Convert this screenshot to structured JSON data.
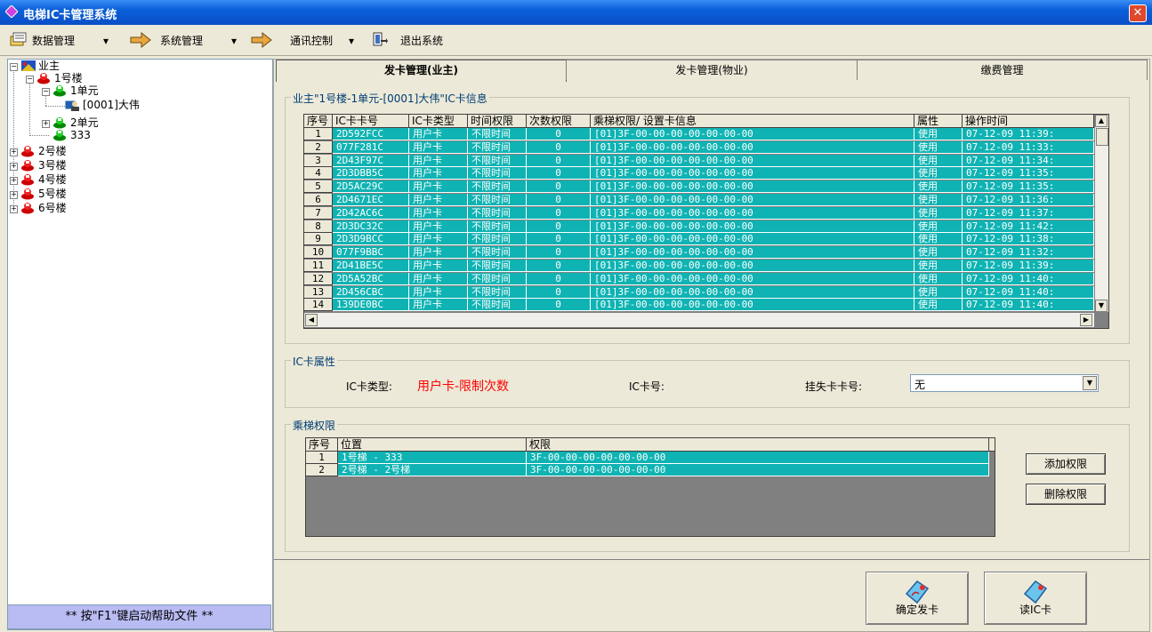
{
  "window": {
    "title": "电梯IC卡管理系统",
    "close": "✕"
  },
  "menu": [
    {
      "label": "数据管理",
      "arrow": "▾"
    },
    {
      "label": "系统管理",
      "arrow": "▾"
    },
    {
      "label": "通讯控制",
      "arrow": "▾"
    },
    {
      "label": "退出系统"
    }
  ],
  "tree": {
    "root": "业主",
    "building1": "1号楼",
    "unit1": "1单元",
    "owner": "[0001]大伟",
    "unit2": "2单元",
    "unit333": "333",
    "b2": "2号楼",
    "b3": "3号楼",
    "b4": "4号楼",
    "b5": "5号楼",
    "b6": "6号楼"
  },
  "help_text": "** 按\"F1\"键启动帮助文件 **",
  "tabs": [
    "发卡管理(业主)",
    "发卡管理(物业)",
    "缴费管理"
  ],
  "card_info": {
    "title": "业主\"1号楼-1单元-[0001]大伟\"IC卡信息",
    "columns": [
      "序号",
      "IC卡卡号",
      "IC卡类型",
      "时间权限",
      "次数权限",
      "乘梯权限/ 设置卡信息",
      "属性",
      "操作时间"
    ],
    "rows": [
      [
        "1",
        "2D592FCC",
        "用户卡",
        "不限时间",
        "0",
        "[01]3F-00-00-00-00-00-00-00",
        "使用",
        "07-12-09 11:39:"
      ],
      [
        "2",
        "077F281C",
        "用户卡",
        "不限时间",
        "0",
        "[01]3F-00-00-00-00-00-00-00",
        "使用",
        "07-12-09 11:33:"
      ],
      [
        "3",
        "2D43F97C",
        "用户卡",
        "不限时间",
        "0",
        "[01]3F-00-00-00-00-00-00-00",
        "使用",
        "07-12-09 11:34:"
      ],
      [
        "4",
        "2D3DBB5C",
        "用户卡",
        "不限时间",
        "0",
        "[01]3F-00-00-00-00-00-00-00",
        "使用",
        "07-12-09 11:35:"
      ],
      [
        "5",
        "2D5AC29C",
        "用户卡",
        "不限时间",
        "0",
        "[01]3F-00-00-00-00-00-00-00",
        "使用",
        "07-12-09 11:35:"
      ],
      [
        "6",
        "2D4671EC",
        "用户卡",
        "不限时间",
        "0",
        "[01]3F-00-00-00-00-00-00-00",
        "使用",
        "07-12-09 11:36:"
      ],
      [
        "7",
        "2D42AC6C",
        "用户卡",
        "不限时间",
        "0",
        "[01]3F-00-00-00-00-00-00-00",
        "使用",
        "07-12-09 11:37:"
      ],
      [
        "8",
        "2D3DC32C",
        "用户卡",
        "不限时间",
        "0",
        "[01]3F-00-00-00-00-00-00-00",
        "使用",
        "07-12-09 11:42:"
      ],
      [
        "9",
        "2D3D9BCC",
        "用户卡",
        "不限时间",
        "0",
        "[01]3F-00-00-00-00-00-00-00",
        "使用",
        "07-12-09 11:38:"
      ],
      [
        "10",
        "077F9BBC",
        "用户卡",
        "不限时间",
        "0",
        "[01]3F-00-00-00-00-00-00-00",
        "使用",
        "07-12-09 11:32:"
      ],
      [
        "11",
        "2D41BE5C",
        "用户卡",
        "不限时间",
        "0",
        "[01]3F-00-00-00-00-00-00-00",
        "使用",
        "07-12-09 11:39:"
      ],
      [
        "12",
        "2D5A52BC",
        "用户卡",
        "不限时间",
        "0",
        "[01]3F-00-00-00-00-00-00-00",
        "使用",
        "07-12-09 11:40:"
      ],
      [
        "13",
        "2D456CBC",
        "用户卡",
        "不限时间",
        "0",
        "[01]3F-00-00-00-00-00-00-00",
        "使用",
        "07-12-09 11:40:"
      ],
      [
        "14",
        "139DE0BC",
        "用户卡",
        "不限时间",
        "0",
        "[01]3F-00-00-00-00-00-00-00",
        "使用",
        "07-12-09 11:40:"
      ]
    ]
  },
  "card_attr": {
    "title": "IC卡属性",
    "type_label": "IC卡类型:",
    "type_value": "用户卡-限制次数",
    "type_value_color": "#ff0000",
    "cardno_label": "IC卡号:",
    "lost_label": "挂失卡卡号:",
    "lost_value": "无"
  },
  "elevator": {
    "title": "乘梯权限",
    "columns": [
      "序号",
      "位置",
      "权限"
    ],
    "rows": [
      [
        "1",
        "1号梯 - 333",
        "3F-00-00-00-00-00-00-00"
      ],
      [
        "2",
        "2号梯 - 2号梯",
        "3F-00-00-00-00-00-00-00"
      ]
    ],
    "add_label": "添加权限",
    "delete_label": "删除权限"
  },
  "bottom_buttons": {
    "issue": "确定发卡",
    "read": "读IC卡"
  },
  "colors": {
    "grid_cell": "#0fb3b3",
    "title_bar": "#0a5fd8",
    "help_bar": "#b9bbf3"
  }
}
